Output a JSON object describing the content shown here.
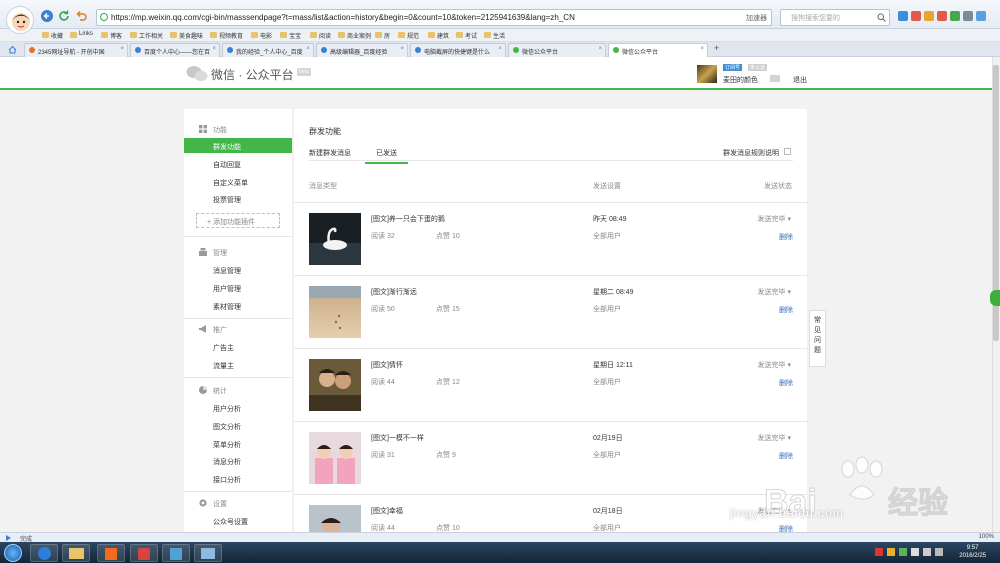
{
  "browser": {
    "url": "https://mp.weixin.qq.com/cgi-bin/masssendpage?t=mass/list&action=history&begin=0&count=10&token=2125941639&lang=zh_CN",
    "url_right": "加速器",
    "search_placeholder": "搜狗搜索您要的",
    "status_text": "完成",
    "status_right": "100%"
  },
  "bookmarks": [
    "收藏",
    "Links",
    "博客",
    "工作相关",
    "美食趣味",
    "视频教育",
    "电影",
    "宝宝",
    "阅读",
    "商业案例",
    "房",
    "规范",
    "建筑",
    "考试",
    "生活"
  ],
  "tabs": [
    {
      "label": "2345网址导航 - 开创中国"
    },
    {
      "label": "百度个人中心——您在百"
    },
    {
      "label": "我的经验_个人中心_百度"
    },
    {
      "label": "高级编辑器_百度经验"
    },
    {
      "label": "电脑截屏的快捷键是什么"
    },
    {
      "label": "微信公众平台"
    },
    {
      "label": "微信公众平台"
    }
  ],
  "header": {
    "logo_text": "微信 · 公众平台",
    "logo_badge": "beta",
    "account_badge1": "订阅号",
    "account_badge2": "未认证",
    "account_name": "麦田的颜色",
    "logout": "退出"
  },
  "sidebar": {
    "sections": [
      {
        "title": "功能",
        "icon": "grid-icon",
        "items": [
          "群发功能",
          "自动回复",
          "自定义菜单",
          "投票管理"
        ]
      },
      {
        "title": "管理",
        "icon": "manage-icon",
        "items": [
          "消息管理",
          "用户管理",
          "素材管理"
        ]
      },
      {
        "title": "推广",
        "icon": "megaphone-icon",
        "items": [
          "广告主",
          "流量主"
        ]
      },
      {
        "title": "统计",
        "icon": "chart-icon",
        "items": [
          "用户分析",
          "图文分析",
          "菜单分析",
          "消息分析",
          "接口分析"
        ]
      },
      {
        "title": "设置",
        "icon": "gear-icon",
        "items": [
          "公众号设置"
        ]
      }
    ],
    "add_plugin": "+ 添加功能插件"
  },
  "main": {
    "title": "群发功能",
    "tabs": [
      "新建群发消息",
      "已发送"
    ],
    "rule_link": "群发消息规则说明",
    "columns": [
      "消息类型",
      "发送设置",
      "发送状态"
    ],
    "rows": [
      {
        "title": "[图文]养一只会下蛋的鹅",
        "read": "阅读 32",
        "like": "点赞 10",
        "date": "昨天 08:49",
        "audience": "全部用户",
        "status": "发送完毕",
        "delete": "删除"
      },
      {
        "title": "[图文]渐行渐远",
        "read": "阅读 50",
        "like": "点赞 15",
        "date": "星期二 08:49",
        "audience": "全部用户",
        "status": "发送完毕",
        "delete": "删除"
      },
      {
        "title": "[图文]情怀",
        "read": "阅读 44",
        "like": "点赞 12",
        "date": "星期日 12:11",
        "audience": "全部用户",
        "status": "发送完毕",
        "delete": "删除"
      },
      {
        "title": "[图文]一模不一样",
        "read": "阅读 31",
        "like": "点赞 9",
        "date": "02月19日",
        "audience": "全部用户",
        "status": "发送完毕",
        "delete": "删除"
      },
      {
        "title": "[图文]幸福",
        "read": "阅读 44",
        "like": "点赞 10",
        "date": "02月18日",
        "audience": "全部用户",
        "status": "发送完毕",
        "delete": "删除"
      }
    ],
    "faq": [
      "常",
      "见",
      "问",
      "题"
    ]
  },
  "taskbar": {
    "time": "9:57",
    "date": "2016/2/25"
  },
  "watermark": {
    "text": "jingyan.baidu.com"
  },
  "colors": {
    "wechat_green": "#44b549",
    "link_blue": "#3a6eb8"
  }
}
